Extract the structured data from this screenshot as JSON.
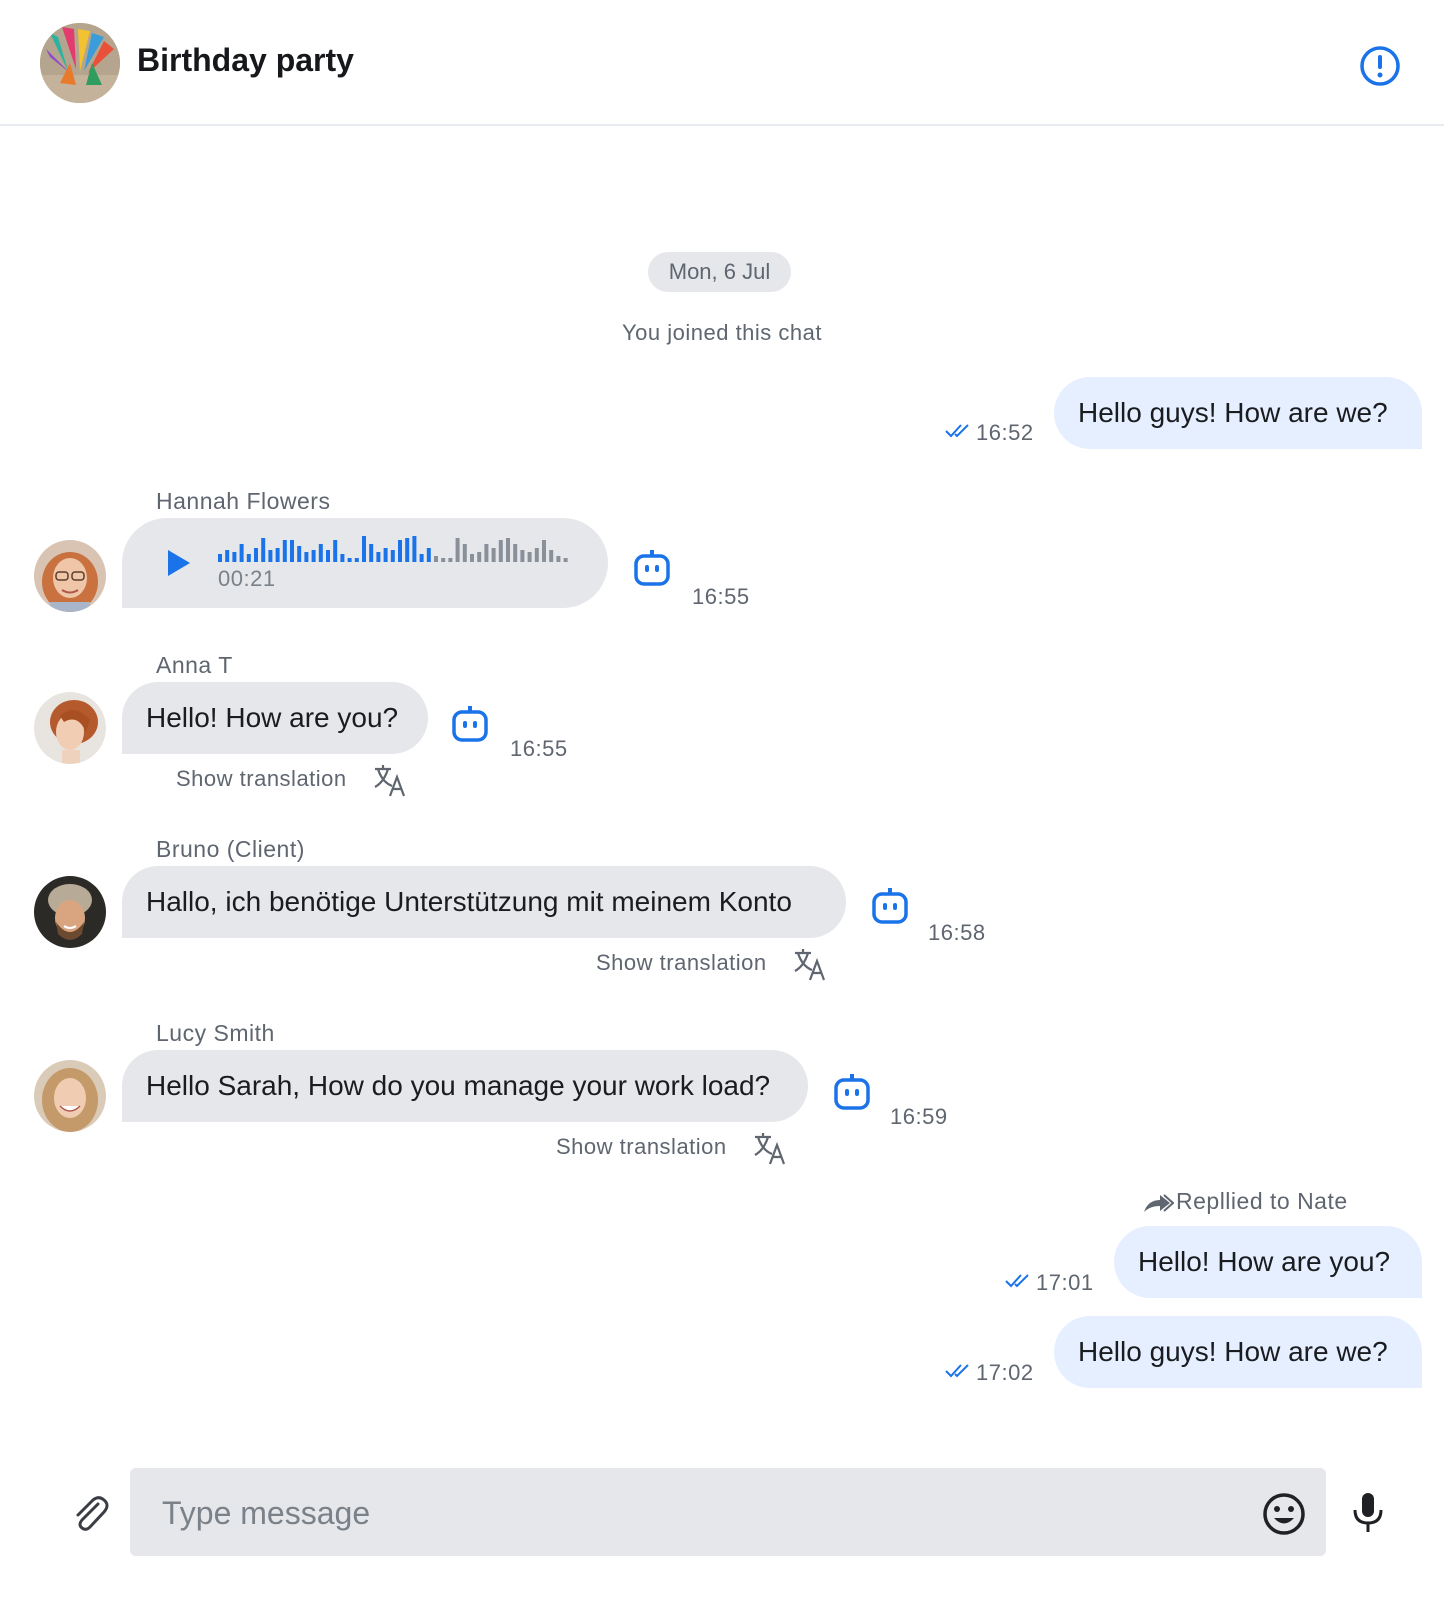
{
  "header": {
    "title": "Birthday party",
    "avatar_icon": "party-balloons-image",
    "info_icon": "info-circle-icon"
  },
  "chat": {
    "date_label": "Mon, 6 Jul",
    "system_message": "You joined this chat",
    "show_translation_label": "Show translation",
    "messages": [
      {
        "direction": "outgoing",
        "text": "Hello guys! How are we?",
        "time": "16:52",
        "status": "read"
      },
      {
        "direction": "incoming",
        "sender": "Hannah Flowers",
        "type": "voice",
        "duration": "00:21",
        "time": "16:55"
      },
      {
        "direction": "incoming",
        "sender": "Anna T",
        "text": "Hello! How are you?",
        "time": "16:55"
      },
      {
        "direction": "incoming",
        "sender": "Bruno (Client)",
        "text": "Hallo, ich benötige Unterstützung mit meinem Konto",
        "time": "16:58"
      },
      {
        "direction": "incoming",
        "sender": "Lucy Smith",
        "text": "Hello Sarah, How do you manage your work load?",
        "time": "16:59"
      },
      {
        "direction": "outgoing",
        "reply_label": "Repllied to Nate",
        "text": "Hello! How are you?",
        "time": "17:01",
        "status": "read"
      },
      {
        "direction": "outgoing",
        "text": "Hello guys! How are we?",
        "time": "17:02",
        "status": "read"
      }
    ]
  },
  "composer": {
    "placeholder": "Type message",
    "attach_icon": "paperclip-icon",
    "emoji_icon": "smiley-icon",
    "mic_icon": "microphone-icon"
  },
  "colors": {
    "accent": "#1a73e8",
    "outgoing_bubble": "#e5efff",
    "incoming_bubble": "#e5e7ea",
    "muted_text": "#5f6670"
  }
}
